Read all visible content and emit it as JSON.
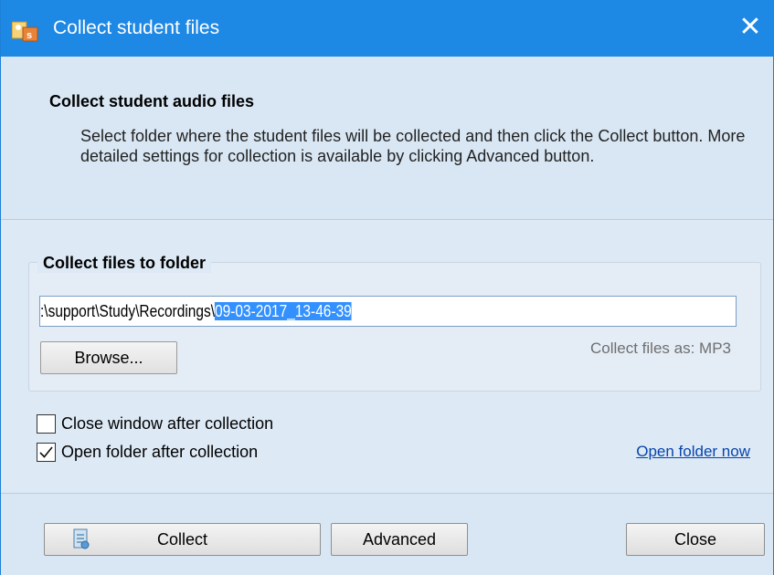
{
  "window": {
    "title": "Collect student files",
    "close_glyph": "✕"
  },
  "header": {
    "title": "Collect student audio files",
    "description": "Select folder where the student files will be collected and then click the Collect button. More detailed settings for collection is available by clicking Advanced button."
  },
  "folder_group": {
    "legend": "Collect files to folder",
    "path_prefix": ":\\support\\Study\\Recordings\\",
    "path_selected": "09-03-2017_13-46-39",
    "browse_label": "Browse...",
    "collect_as": "Collect files as: MP3"
  },
  "options": {
    "close_window": {
      "label": "Close window after collection",
      "checked": false
    },
    "open_folder": {
      "label": "Open folder after collection",
      "checked": true
    },
    "open_folder_now_link": "Open folder now"
  },
  "footer": {
    "collect_label": "Collect",
    "advanced_label": "Advanced",
    "close_label": "Close"
  },
  "colors": {
    "titlebar": "#1e88e5",
    "selection": "#3390ff",
    "link": "#0645ad"
  },
  "icons": {
    "app": "app-icon",
    "window_close": "close-icon",
    "collect": "collect-icon",
    "checkmark": "checkmark-icon"
  }
}
